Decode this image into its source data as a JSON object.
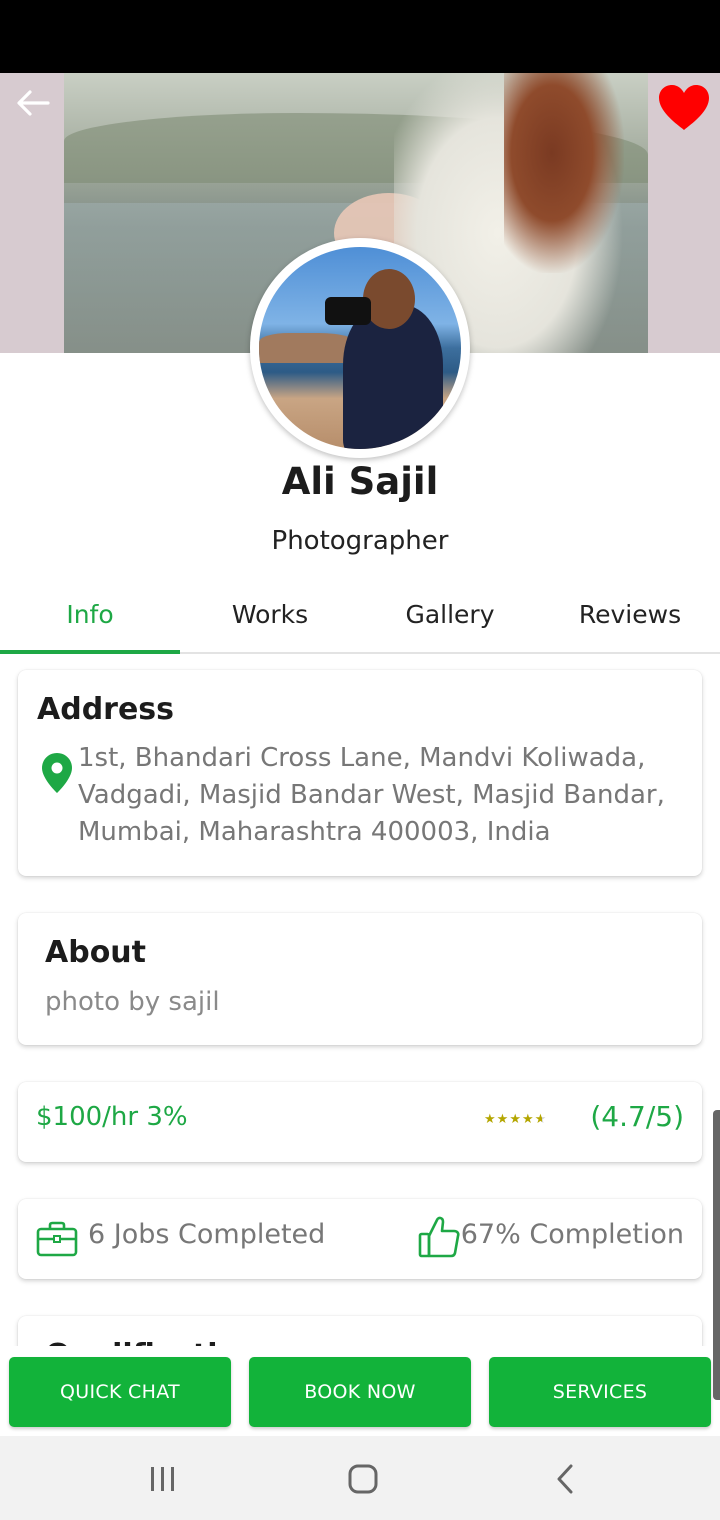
{
  "profile": {
    "name": "Ali Sajil",
    "role": "Photographer"
  },
  "header": {
    "back_icon": "arrow-left-icon",
    "favorite_icon": "heart-icon",
    "favorite_color": "#ff0000"
  },
  "tabs": [
    {
      "label": "Info",
      "active": true
    },
    {
      "label": "Works",
      "active": false
    },
    {
      "label": "Gallery",
      "active": false
    },
    {
      "label": "Reviews",
      "active": false
    }
  ],
  "address": {
    "title": "Address",
    "line1": "1st, Bhandari Cross Lane, Mandvi Koliwada,",
    "line2": "Vadgadi, Masjid Bandar West, Masjid Bandar,",
    "line3": "Mumbai, Maharashtra 400003, India"
  },
  "about": {
    "title": "About",
    "text": "photo by sajil"
  },
  "pricing": {
    "rate": "$100/hr 3%",
    "stars": 4.7,
    "rating_label": "(4.7/5)"
  },
  "stats": {
    "jobs": "6 Jobs Completed",
    "completion": "67% Completion"
  },
  "qualification": {
    "title": "Qualification"
  },
  "actions": {
    "quick_chat": "QUICK CHAT",
    "book_now": "BOOK NOW",
    "services": "SERVICES"
  },
  "colors": {
    "accent": "#1ea845",
    "button": "#12b33a",
    "muted_text": "#777777",
    "star": "#b4a600"
  }
}
